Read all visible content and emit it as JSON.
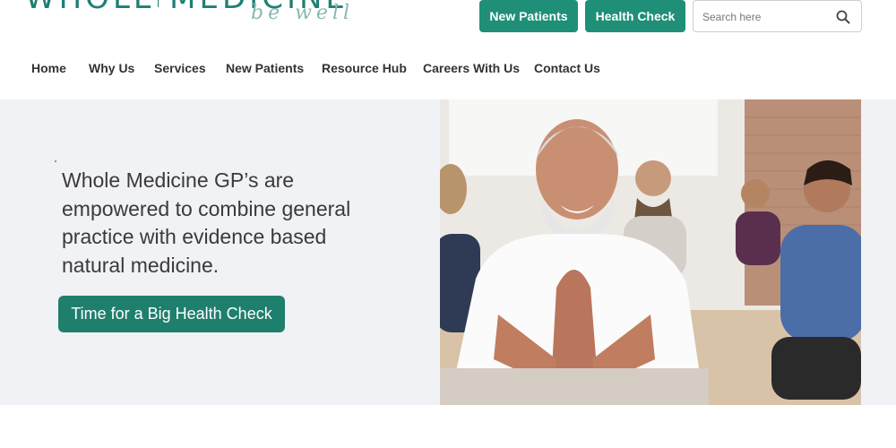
{
  "header": {
    "logo_text": "WHOLE MEDICINE",
    "logo_tagline": "be well",
    "buttons": {
      "new_patients": "New Patients",
      "health_check": "Health Check"
    },
    "search": {
      "placeholder": "Search here",
      "icon": "search-icon"
    }
  },
  "nav": {
    "items": [
      {
        "label": "Home"
      },
      {
        "label": "Why Us"
      },
      {
        "label": "Services"
      },
      {
        "label": "New Patients"
      },
      {
        "label": "Resource Hub"
      },
      {
        "label": "Careers With Us"
      },
      {
        "label": "Contact Us"
      }
    ]
  },
  "hero": {
    "headline": "Whole Medicine GP’s are empowered to combine general practice with evidence based natural medicine.",
    "cta": "Time for a Big Health Check"
  },
  "colors": {
    "brand_green": "#1f8f78",
    "hero_bg": "#f1f2f6"
  }
}
